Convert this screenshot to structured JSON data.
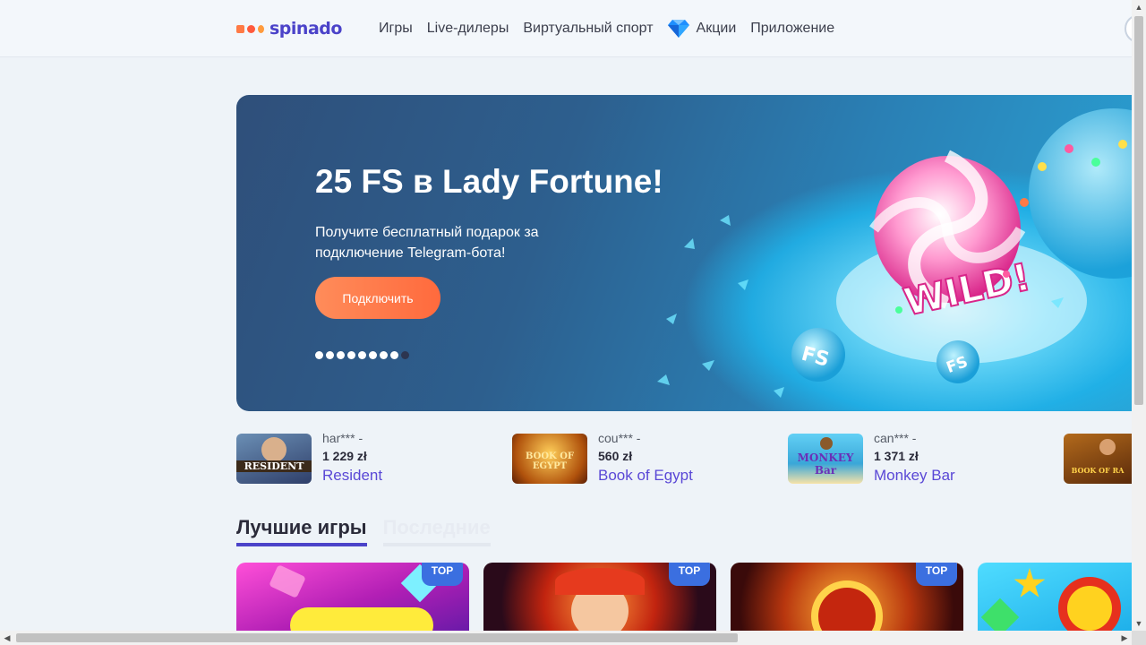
{
  "header": {
    "logo_text": "spinado",
    "nav": [
      {
        "label": "Игры",
        "icon": null
      },
      {
        "label": "Live-дилеры",
        "icon": null
      },
      {
        "label": "Виртуальный спорт",
        "icon": null
      },
      {
        "label": "Акции",
        "icon": "diamond-icon"
      },
      {
        "label": "Приложение",
        "icon": null
      }
    ]
  },
  "banner": {
    "title": "25 FS в Lady Fortune!",
    "subtitle": "Получите бесплатный подарок за подключение Telegram-бота!",
    "button_label": "Подключить",
    "art_text": {
      "wild": "WILD!",
      "fs1": "FS",
      "fs2": "FS"
    },
    "slides_total": 9,
    "active_slide": 9
  },
  "winners": [
    {
      "user": "har*** -",
      "amount": "1 229 zł",
      "game": "Resident",
      "thumb_text": "RESIDENT"
    },
    {
      "user": "cou*** -",
      "amount": "560 zł",
      "game": "Book of Egypt",
      "thumb_text": "BOOK OF EGYPT"
    },
    {
      "user": "can*** -",
      "amount": "1 371 zł",
      "game": "Monkey Bar",
      "thumb_text": "MONKEY Bar"
    },
    {
      "user": "",
      "amount": "",
      "game": "",
      "thumb_text": "BOOK OF RA"
    }
  ],
  "tabs": [
    {
      "label": "Лучшие игры",
      "active": true
    },
    {
      "label": "Последние",
      "active": false
    }
  ],
  "cards": [
    {
      "badge": "TOP",
      "theme": "candy"
    },
    {
      "badge": "TOP",
      "theme": "joker"
    },
    {
      "badge": "TOP",
      "theme": "coins"
    },
    {
      "badge": "",
      "theme": "fruits"
    }
  ],
  "colors": {
    "brand": "#4b43c9",
    "accent_button": "#ff7a45",
    "badge": "#3b6fe0",
    "link": "#5a48d6"
  }
}
